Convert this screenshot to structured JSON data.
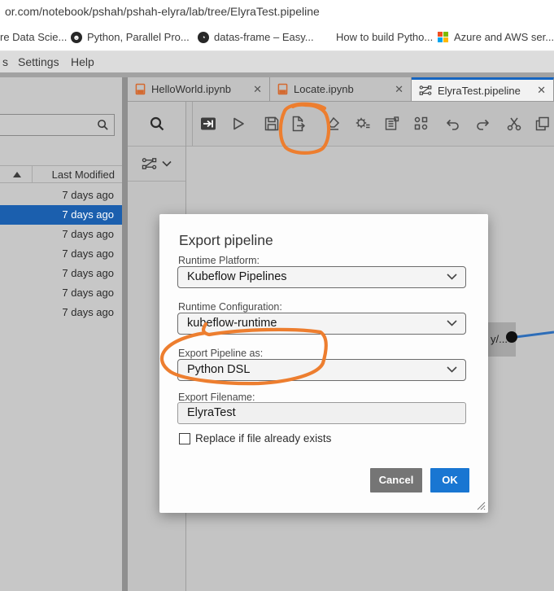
{
  "browser": {
    "url": "or.com/notebook/pshah/pshah-elyra/lab/tree/ElyraTest.pipeline",
    "bookmarks": [
      {
        "label": "re Data Scie...",
        "icon": "none"
      },
      {
        "label": "Python, Parallel Pro...",
        "icon": "oreilly-icon"
      },
      {
        "label": "datas-frame – Easy...",
        "icon": "globe-icon"
      },
      {
        "label": "How to build Pytho...",
        "icon": "none"
      },
      {
        "label": "Azure and AWS ser...",
        "icon": "microsoft-logo"
      }
    ]
  },
  "menubar": {
    "items": [
      "s",
      "Settings",
      "Help"
    ]
  },
  "filebrowser": {
    "sort_header": "Last Modified",
    "rows": [
      "7 days ago",
      "7 days ago",
      "7 days ago",
      "7 days ago",
      "7 days ago",
      "7 days ago",
      "7 days ago"
    ],
    "selected_index": 1
  },
  "tabs": [
    {
      "label": "HelloWorld.ipynb",
      "icon": "notebook-icon",
      "close": "✕",
      "active": false
    },
    {
      "label": "Locate.ipynb",
      "icon": "notebook-icon",
      "close": "✕",
      "active": false
    },
    {
      "label": "ElyraTest.pipeline",
      "icon": "pipeline-icon",
      "close": "✕",
      "active": true
    }
  ],
  "toolbar": {
    "icons": [
      "open-palette",
      "run-pipeline",
      "save-pipeline",
      "export-pipeline",
      "clear-pipeline",
      "runtime-configuration",
      "runtime-images",
      "arrange",
      "undo",
      "redo",
      "cut",
      "copy"
    ]
  },
  "canvas": {
    "node_label": "y/..."
  },
  "dialog": {
    "title": "Export pipeline",
    "fields": [
      {
        "label": "Runtime Platform:",
        "value": "Kubeflow Pipelines",
        "type": "select"
      },
      {
        "label": "Runtime Configuration:",
        "value": "kubeflow-runtime",
        "type": "select"
      },
      {
        "label": "Export Pipeline as:",
        "value": "Python DSL",
        "type": "select"
      },
      {
        "label": "Export Filename:",
        "value": "ElyraTest",
        "type": "text"
      }
    ],
    "checkbox_label": "Replace if file already exists",
    "checkbox_checked": false,
    "cancel_label": "Cancel",
    "ok_label": "OK"
  },
  "colors": {
    "active_tab_accent": "#1565c0",
    "selection_blue": "#1b5fae",
    "annotation_orange": "#ed7e2f",
    "ok_button_blue": "#1976d2",
    "cancel_button_gray": "#757575",
    "notebook_icon_orange": "#d4692f",
    "edge_blue": "#2d6db8"
  }
}
